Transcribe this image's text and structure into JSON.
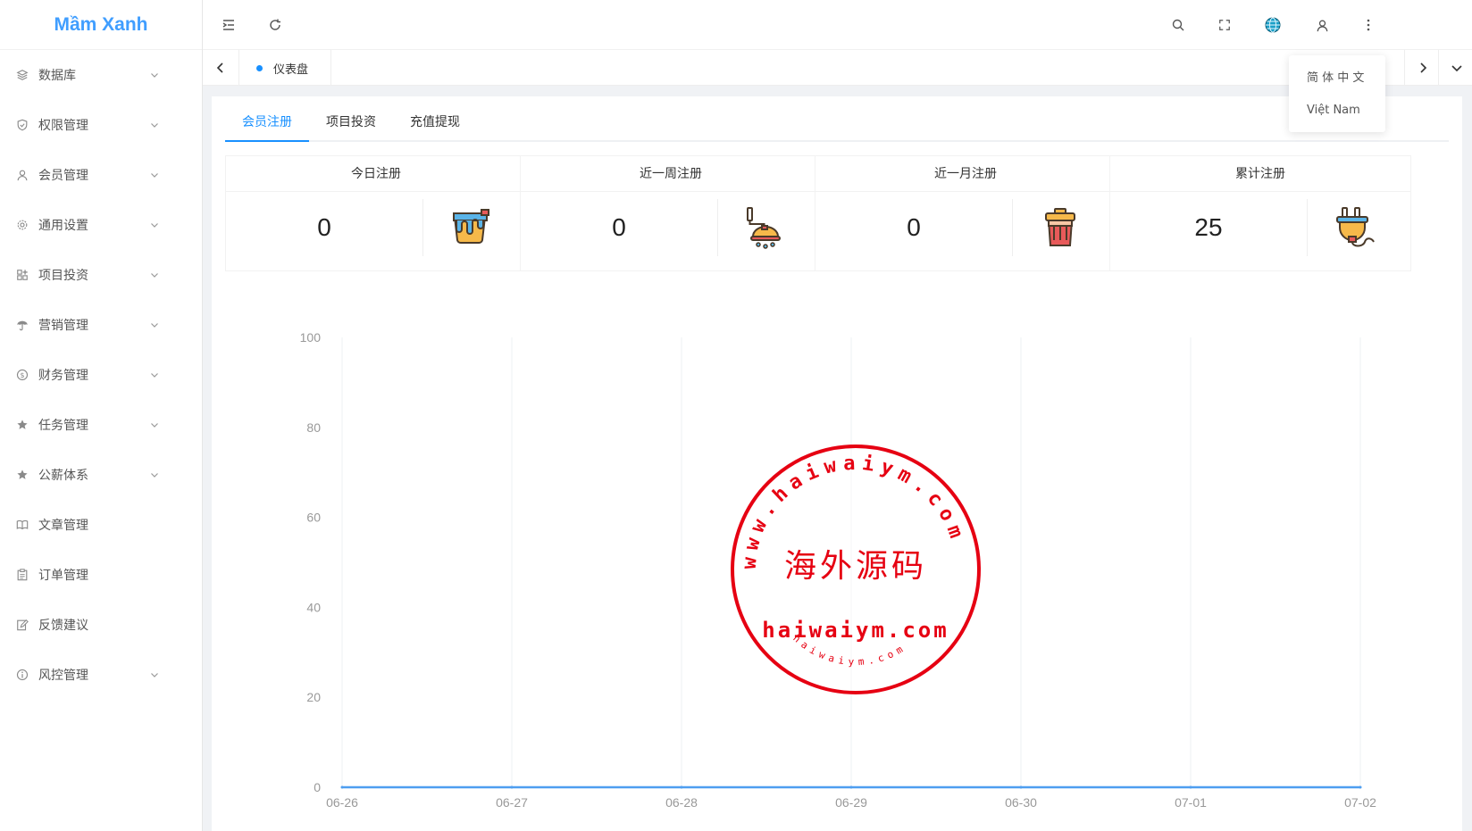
{
  "app": {
    "logo": "Mầm Xanh"
  },
  "sidebar": {
    "items": [
      {
        "label": "数据库",
        "icon": "layers-icon",
        "has_children": true
      },
      {
        "label": "权限管理",
        "icon": "shield-check-icon",
        "has_children": true
      },
      {
        "label": "会员管理",
        "icon": "user-icon",
        "has_children": true
      },
      {
        "label": "通用设置",
        "icon": "gear-icon",
        "has_children": true
      },
      {
        "label": "项目投资",
        "icon": "grid-plus-icon",
        "has_children": true
      },
      {
        "label": "营销管理",
        "icon": "umbrella-icon",
        "has_children": true
      },
      {
        "label": "财务管理",
        "icon": "dollar-icon",
        "has_children": true
      },
      {
        "label": "任务管理",
        "icon": "star-icon",
        "has_children": true
      },
      {
        "label": "公薪体系",
        "icon": "star-icon",
        "has_children": true
      },
      {
        "label": "文章管理",
        "icon": "book-icon",
        "has_children": false
      },
      {
        "label": "订单管理",
        "icon": "clipboard-icon",
        "has_children": false
      },
      {
        "label": "反馈建议",
        "icon": "edit-icon",
        "has_children": false
      },
      {
        "label": "风控管理",
        "icon": "info-icon",
        "has_children": true
      }
    ]
  },
  "tabsbar": {
    "active_tab": "仪表盘"
  },
  "lang_menu": {
    "options": [
      "简 体 中 文",
      "Việt Nam"
    ]
  },
  "content": {
    "tabs": [
      "会员注册",
      "项目投资",
      "充值提现"
    ],
    "active_tab_index": 0,
    "stats": [
      {
        "title": "今日注册",
        "value": "0",
        "icon": "paint-bucket-icon"
      },
      {
        "title": "近一周注册",
        "value": "0",
        "icon": "shower-icon"
      },
      {
        "title": "近一月注册",
        "value": "0",
        "icon": "trash-bin-icon"
      },
      {
        "title": "累计注册",
        "value": "25",
        "icon": "plug-icon"
      }
    ]
  },
  "watermark": {
    "arc_text": "www.haiwaiym.com",
    "center_text": "海外源码",
    "domain": "haiwaiym.com",
    "small_text": "haiwaiym.com",
    "color": "#e60012"
  },
  "chart_data": {
    "type": "line",
    "categories": [
      "06-26",
      "06-27",
      "06-28",
      "06-29",
      "06-30",
      "07-01",
      "07-02"
    ],
    "series": [
      {
        "values": [
          0,
          0,
          0,
          0,
          0,
          0,
          0
        ],
        "color": "#4e9ef0"
      }
    ],
    "y_ticks": [
      0,
      20,
      40,
      60,
      80,
      100
    ],
    "ylim": [
      0,
      100
    ],
    "grid": "vertical"
  }
}
